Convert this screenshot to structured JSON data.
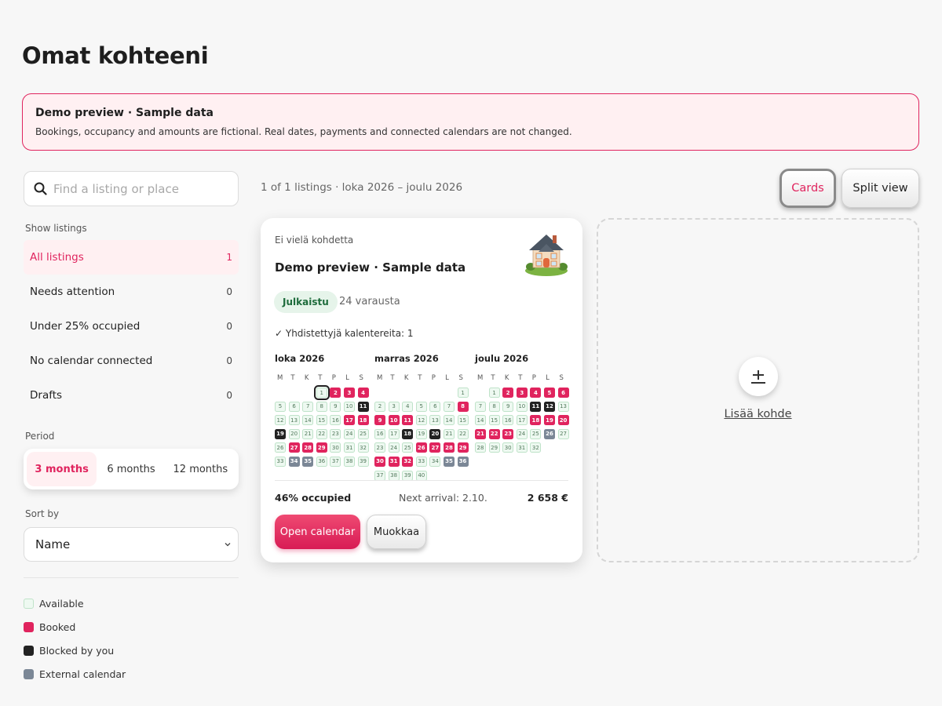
{
  "page": {
    "title": "Omat kohteeni"
  },
  "banner": {
    "title": "Demo preview · Sample data",
    "text": "Bookings, occupancy and amounts are fictional. Real dates, payments and connected calendars are not changed."
  },
  "sidebar": {
    "search_placeholder": "Find a listing or place",
    "show_listings_label": "Show listings",
    "filters": [
      {
        "label": "All listings",
        "count": "1"
      },
      {
        "label": "Needs attention",
        "count": "0"
      },
      {
        "label": "Under 25% occupied",
        "count": "0"
      },
      {
        "label": "No calendar connected",
        "count": "0"
      },
      {
        "label": "Drafts",
        "count": "0"
      }
    ],
    "period_label": "Period",
    "period_options": [
      "3 months",
      "6 months",
      "12 months"
    ],
    "period_selected": "3 months",
    "sort_label": "Sort by",
    "sort_value": "Name",
    "legend": [
      {
        "label": "Available",
        "color": "#eef9f1"
      },
      {
        "label": "Booked",
        "color": "#e0245e"
      },
      {
        "label": "Blocked by you",
        "color": "#222222"
      },
      {
        "label": "External calendar",
        "color": "#7b8796"
      }
    ]
  },
  "toolbar": {
    "summary": "1 of 1 listings · loka 2026 – joulu 2026",
    "cards_label": "Cards",
    "split_label": "Split view"
  },
  "card": {
    "status_line": "Ei vielä kohdetta",
    "image_icon": "house-illustration",
    "name": "Demo preview · Sample data",
    "badge": "Julkaistu",
    "bookings": "24 varausta",
    "calendars": "✓ Yhdistettyjä kalentereita: 1",
    "weekdays": [
      "M",
      "T",
      "K",
      "T",
      "P",
      "L",
      "S"
    ],
    "months": [
      {
        "title": "loka 2026",
        "offset": 3,
        "today": 1,
        "days": "abbbaaaaaakaaaaabbkaaaaaaabbbaaaaeeaaaa"
      },
      {
        "title": "marras 2026",
        "offset": 6,
        "today": 0,
        "days": "aaaaaaabbbbaaaaaakakaaaaabbbbbbbaaeeaaaa"
      },
      {
        "title": "joulu 2026",
        "offset": 1,
        "today": 0,
        "days": "abbbbbaaaakkaaaaabbbbbbaaeaaaaaa"
      }
    ],
    "occupied": "46% occupied",
    "next_arrival": "Next arrival: 2.10.",
    "amount": "2 658 €",
    "open_calendar_label": "Open calendar",
    "edit_label": "Muokkaa"
  },
  "add_listing": {
    "label": "Lisää kohde",
    "icon": "plus-icon"
  },
  "colors": {
    "accent": "#e0245e",
    "accent_bg": "#fff0f2"
  }
}
